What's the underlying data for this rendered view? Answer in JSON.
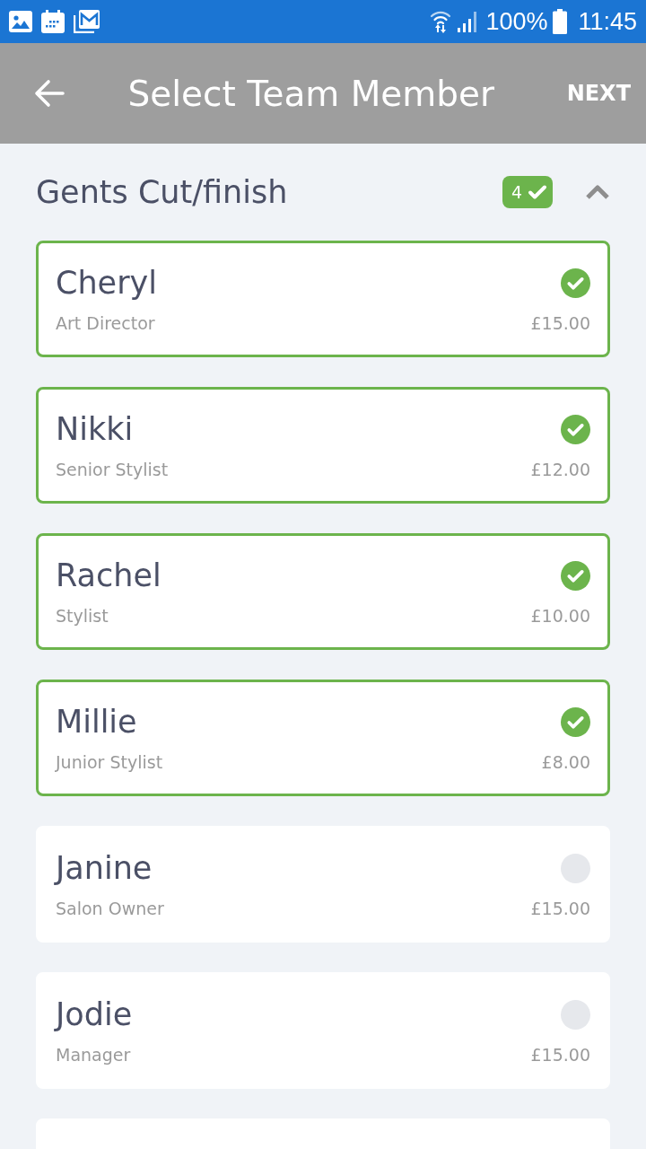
{
  "status_bar": {
    "battery": "100%",
    "time": "11:45"
  },
  "app_bar": {
    "title": "Select Team Member",
    "action": "NEXT"
  },
  "section": {
    "title": "Gents Cut/finish",
    "selected_count": "4",
    "expanded": true
  },
  "members": [
    {
      "name": "Cheryl",
      "role": "Art Director",
      "price": "£15.00",
      "selected": true
    },
    {
      "name": "Nikki",
      "role": "Senior Stylist",
      "price": "£12.00",
      "selected": true
    },
    {
      "name": "Rachel",
      "role": "Stylist",
      "price": "£10.00",
      "selected": true
    },
    {
      "name": "Millie",
      "role": "Junior Stylist",
      "price": "£8.00",
      "selected": true
    },
    {
      "name": "Janine",
      "role": "Salon Owner",
      "price": "£15.00",
      "selected": false
    },
    {
      "name": "Jodie",
      "role": "Manager",
      "price": "£15.00",
      "selected": false
    },
    {
      "selected": false
    }
  ]
}
